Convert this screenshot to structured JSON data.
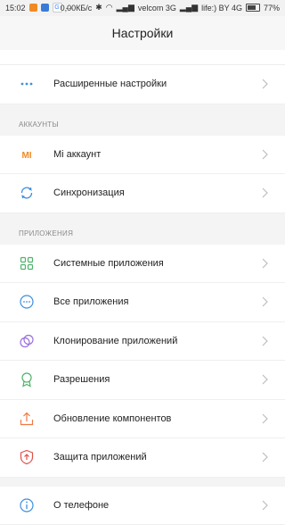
{
  "status_bar": {
    "time": "15:02",
    "speed": "0,00КБ/с",
    "carrier1": "velcom 3G",
    "carrier2": "life:) BY 4G",
    "battery": "77%"
  },
  "header": {
    "title": "Настройки"
  },
  "rows_top": [
    {
      "label": "Расширенные настройки",
      "icon": "more-dots-icon"
    }
  ],
  "sections": {
    "accounts": "АККАУНТЫ",
    "apps": "ПРИЛОЖЕНИЯ"
  },
  "account_rows": [
    {
      "label": "Mi аккаунт",
      "icon": "mi-icon"
    },
    {
      "label": "Синхронизация",
      "icon": "sync-icon"
    }
  ],
  "app_rows": [
    {
      "label": "Системные приложения",
      "icon": "grid-icon"
    },
    {
      "label": "Все приложения",
      "icon": "apps-circle-icon"
    },
    {
      "label": "Клонирование приложений",
      "icon": "clone-icon"
    },
    {
      "label": "Разрешения",
      "icon": "permission-icon"
    },
    {
      "label": "Обновление компонентов",
      "icon": "update-icon"
    },
    {
      "label": "Защита приложений",
      "icon": "shield-icon"
    }
  ],
  "bottom_rows": [
    {
      "label": "О телефоне",
      "icon": "info-icon"
    }
  ],
  "colors": {
    "accent_blue": "#3d8fe0",
    "mi_orange": "#f08a24",
    "green": "#4db36b",
    "purple": "#9a6de0",
    "red": "#e0504a",
    "orange": "#ee7a45"
  }
}
